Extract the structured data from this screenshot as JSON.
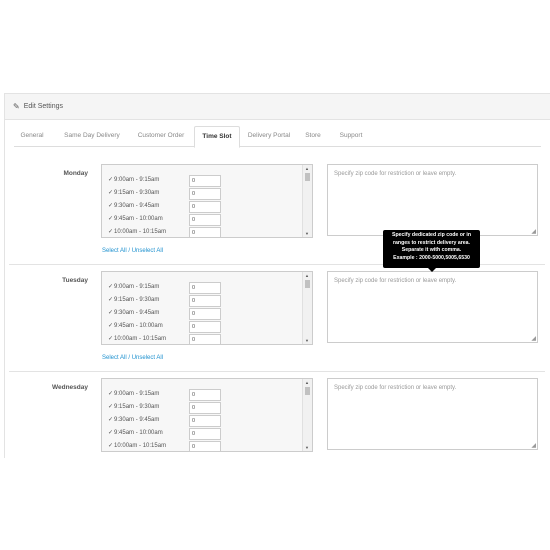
{
  "header": {
    "title": "Edit Settings"
  },
  "tabs": [
    {
      "label": "General"
    },
    {
      "label": "Same Day Delivery"
    },
    {
      "label": "Customer Order"
    },
    {
      "label": "Time Slot",
      "active": true
    },
    {
      "label": "Delivery Portal"
    },
    {
      "label": "Store"
    },
    {
      "label": "Support"
    }
  ],
  "days": [
    {
      "name": "Monday",
      "slots": [
        {
          "time": "9:00am - 9:15am",
          "value": "0"
        },
        {
          "time": "9:15am - 9:30am",
          "value": "0"
        },
        {
          "time": "9:30am - 9:45am",
          "value": "0"
        },
        {
          "time": "9:45am - 10:00am",
          "value": "0"
        },
        {
          "time": "10:00am - 10:15am",
          "value": "0"
        }
      ],
      "select_all": "Select All",
      "unselect_all": "Unselect All",
      "zip_placeholder": "Specify zip code for restriction or leave empty."
    },
    {
      "name": "Tuesday",
      "slots": [
        {
          "time": "9:00am - 9:15am",
          "value": "0"
        },
        {
          "time": "9:15am - 9:30am",
          "value": "0"
        },
        {
          "time": "9:30am - 9:45am",
          "value": "0"
        },
        {
          "time": "9:45am - 10:00am",
          "value": "0"
        },
        {
          "time": "10:00am - 10:15am",
          "value": "0"
        }
      ],
      "select_all": "Select All",
      "unselect_all": "Unselect All",
      "zip_placeholder": "Specify zip code for restriction or leave empty."
    },
    {
      "name": "Wednesday",
      "slots": [
        {
          "time": "9:00am - 9:15am",
          "value": "0"
        },
        {
          "time": "9:15am - 9:30am",
          "value": "0"
        },
        {
          "time": "9:30am - 9:45am",
          "value": "0"
        },
        {
          "time": "9:45am - 10:00am",
          "value": "0"
        },
        {
          "time": "10:00am - 10:15am",
          "value": "0"
        }
      ],
      "zip_placeholder": "Specify zip code for restriction or leave empty."
    }
  ],
  "tooltip": {
    "lines": [
      "Specify dedicated zip code or in",
      "ranges to restrict delivery area.",
      "Separate it with comma.",
      "Example : 2000-5000,5005,6530"
    ]
  },
  "icons": {
    "edit": "pencil-icon",
    "check": "checkmark-icon"
  },
  "colors": {
    "link": "#1e91cf",
    "tooltip_bg": "#000000"
  }
}
